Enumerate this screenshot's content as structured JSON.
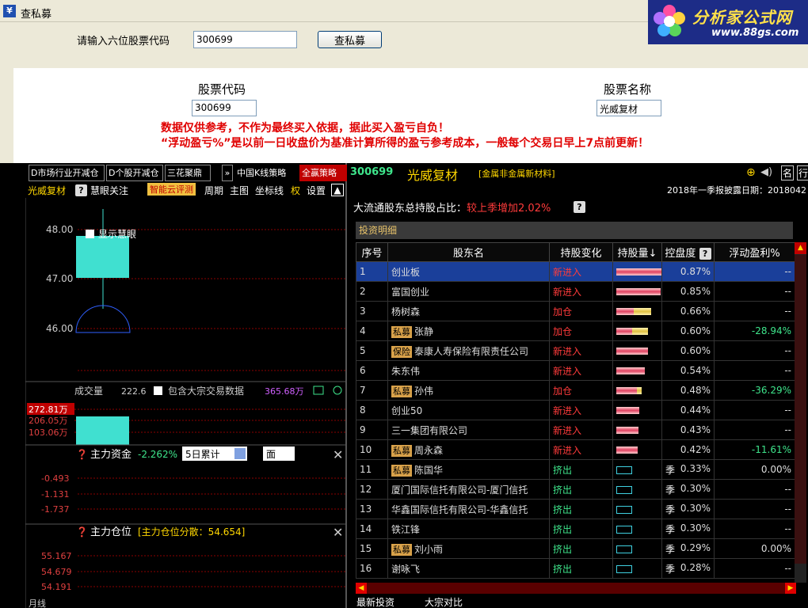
{
  "window": {
    "title": "查私募"
  },
  "logo": {
    "text": "分析家公式网",
    "url": "www.88gs.com"
  },
  "query": {
    "label": "请输入六位股票代码",
    "value": "300699",
    "button": "查私募"
  },
  "info": {
    "code_label": "股票代码",
    "code_value": "300699",
    "name_label": "股票名称",
    "name_value": "光威复材",
    "disclaimer1": "数据仅供参考，不作为最终买入依据，据此买入盈亏自负！",
    "disclaimer2": "“浮动盈亏%”是以前一日收盘价为基准计算所得的盈亏参考成本，一般每个交易日早上7点前更新！"
  },
  "left_tabs": [
    "D市场行业开减仓",
    "D个股开减仓",
    "三花聚鼎",
    "中国K线策略",
    "全赢策略"
  ],
  "left_toolbar": {
    "stock": "光威复材",
    "watch": "慧眼关注",
    "ai": "智能云评测",
    "period": "周期",
    "main": "主图",
    "coord": "坐标线",
    "right": "权",
    "settings": "设置"
  },
  "chart": {
    "price_ticks": [
      "48.00",
      "47.00",
      "46.00"
    ],
    "show_eye": "显示慧眼",
    "volume": {
      "label": "成交量",
      "value": "222.6",
      "include": "包含大宗交易数据",
      "value2": "365.68万",
      "ticks": [
        "272.81万",
        "206.05万",
        "103.06万"
      ]
    },
    "capital": {
      "label": "主力资金",
      "value": "-2.262%",
      "period": "5日累计",
      "face": "面",
      "ticks": [
        "-0.493",
        "-1.131",
        "-1.737"
      ]
    },
    "position": {
      "label": "主力仓位",
      "bracket": "[主力仓位分散：54.654]",
      "ticks": [
        "55.167",
        "54.679",
        "54.191"
      ]
    },
    "footer": "月线"
  },
  "colors": {
    "candle": "#40e0d0",
    "red": "#ff3b3b",
    "green": "#3ee58b"
  },
  "right_header": {
    "code": "300699",
    "name": "光威复材",
    "industry": "[金属非金属新材料]",
    "report": "2018年一季报披露日期：2018042",
    "ratio_label": "大流通股东总持股占比：",
    "ratio_value": "较上季增加2.02%",
    "section": "投资明细",
    "float_title": "浮动盈利%"
  },
  "columns": [
    "序号",
    "股东名",
    "持股变化",
    "持股量↓",
    "控盘度",
    "浮动盈利%"
  ],
  "holders": [
    {
      "no": "1",
      "tag": "",
      "name": "创业板",
      "change": "新进入",
      "type": "new",
      "bar": 58,
      "bar2": 0,
      "season": "",
      "pct": "0.87%",
      "float": "--"
    },
    {
      "no": "2",
      "tag": "",
      "name": "富国创业",
      "change": "新进入",
      "type": "new",
      "bar": 56,
      "bar2": 0,
      "season": "",
      "pct": "0.85%",
      "float": "--"
    },
    {
      "no": "3",
      "tag": "",
      "name": "杨树森",
      "change": "加仓",
      "type": "add",
      "bar": 22,
      "bar2": 22,
      "season": "",
      "pct": "0.66%",
      "float": "--"
    },
    {
      "no": "4",
      "tag": "私募",
      "name": "张静",
      "change": "加仓",
      "type": "add",
      "bar": 20,
      "bar2": 20,
      "season": "",
      "pct": "0.60%",
      "float": "-28.94%"
    },
    {
      "no": "5",
      "tag": "保险",
      "name": "泰康人寿保险有限责任公司",
      "change": "新进入",
      "type": "new",
      "bar": 40,
      "bar2": 0,
      "season": "",
      "pct": "0.60%",
      "float": "--"
    },
    {
      "no": "6",
      "tag": "",
      "name": "朱东伟",
      "change": "新进入",
      "type": "new",
      "bar": 36,
      "bar2": 0,
      "season": "",
      "pct": "0.54%",
      "float": "--"
    },
    {
      "no": "7",
      "tag": "私募",
      "name": "孙伟",
      "change": "加仓",
      "type": "add",
      "bar": 26,
      "bar2": 6,
      "season": "",
      "pct": "0.48%",
      "float": "-36.29%"
    },
    {
      "no": "8",
      "tag": "",
      "name": "创业50",
      "change": "新进入",
      "type": "new",
      "bar": 29,
      "bar2": 0,
      "season": "",
      "pct": "0.44%",
      "float": "--"
    },
    {
      "no": "9",
      "tag": "",
      "name": "三一集团有限公司",
      "change": "新进入",
      "type": "new",
      "bar": 28,
      "bar2": 0,
      "season": "",
      "pct": "0.43%",
      "float": "--"
    },
    {
      "no": "10",
      "tag": "私募",
      "name": "周永森",
      "change": "新进入",
      "type": "new",
      "bar": 27,
      "bar2": 0,
      "season": "",
      "pct": "0.42%",
      "float": "-11.61%"
    },
    {
      "no": "11",
      "tag": "私募",
      "name": "陈国华",
      "change": "挤出",
      "type": "out",
      "bar": 0,
      "bar2": 0,
      "season": "季",
      "pct": "0.33%",
      "float": "0.00%"
    },
    {
      "no": "12",
      "tag": "",
      "name": "厦门国际信托有限公司-厦门信托",
      "change": "挤出",
      "type": "out",
      "bar": 0,
      "bar2": 0,
      "season": "季",
      "pct": "0.30%",
      "float": "--"
    },
    {
      "no": "13",
      "tag": "",
      "name": "华鑫国际信托有限公司-华鑫信托",
      "change": "挤出",
      "type": "out",
      "bar": 0,
      "bar2": 0,
      "season": "季",
      "pct": "0.30%",
      "float": "--"
    },
    {
      "no": "14",
      "tag": "",
      "name": "铁江锋",
      "change": "挤出",
      "type": "out",
      "bar": 0,
      "bar2": 0,
      "season": "季",
      "pct": "0.30%",
      "float": "--"
    },
    {
      "no": "15",
      "tag": "私募",
      "name": "刘小雨",
      "change": "挤出",
      "type": "out",
      "bar": 0,
      "bar2": 0,
      "season": "季",
      "pct": "0.29%",
      "float": "0.00%"
    },
    {
      "no": "16",
      "tag": "",
      "name": "谢咏飞",
      "change": "挤出",
      "type": "out",
      "bar": 0,
      "bar2": 0,
      "season": "季",
      "pct": "0.28%",
      "float": "--"
    }
  ],
  "bottom_tabs": [
    "最新投资",
    "大宗对比"
  ]
}
